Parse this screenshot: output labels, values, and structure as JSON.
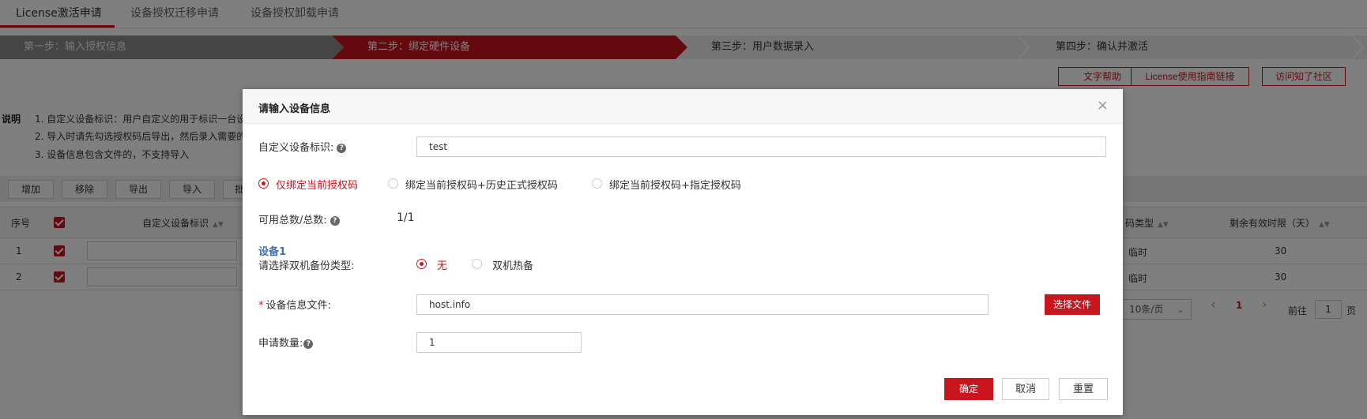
{
  "tabs": [
    {
      "label": "License激活申请"
    },
    {
      "label": "设备授权迁移申请"
    },
    {
      "label": "设备授权卸载申请"
    }
  ],
  "steps": [
    {
      "label": "第一步：输入授权信息"
    },
    {
      "label": "第二步：绑定硬件设备"
    },
    {
      "label": "第三步：用户数据录入"
    },
    {
      "label": "第四步：确认并激活"
    }
  ],
  "top_buttons": {
    "text_help": "文字帮助",
    "license_guide": "License使用指南链接",
    "community": "访问知了社区"
  },
  "description": {
    "label": "说明",
    "lines": [
      "1. 自定义设备标识：用户自定义的用于标识一台设",
      "2. 导入时请先勾选授权码后导出，然后录入需要的",
      "3. 设备信息包含文件的，不支持导入"
    ]
  },
  "toolbar": {
    "add": "增加",
    "remove": "移除",
    "export": "导出",
    "import": "导入",
    "batch": "批"
  },
  "table": {
    "headers": {
      "index": "序号",
      "device_id": "自定义设备标识",
      "code_type": "码类型",
      "remaining": "剩余有效时限（天）"
    },
    "rows": [
      {
        "index": "1",
        "code_type": "临时",
        "remaining": "30"
      },
      {
        "index": "2",
        "code_type": "临时",
        "remaining": "30"
      }
    ]
  },
  "pager": {
    "page_size": "10条/页",
    "prev": "‹",
    "current": "1",
    "next": "›",
    "goto_label": "前往",
    "goto_value": "1",
    "page_suffix": "页"
  },
  "modal": {
    "title": "请输入设备信息",
    "close": "×",
    "device_id_label": "自定义设备标识:",
    "device_id_value": "test",
    "bind_options": [
      {
        "label": "仅绑定当前授权码",
        "selected": true
      },
      {
        "label": "绑定当前授权码+历史正式授权码",
        "selected": false
      },
      {
        "label": "绑定当前授权码+指定授权码",
        "selected": false
      }
    ],
    "available_label": "可用总数/总数:",
    "available_value": "1/1",
    "device_section": "设备1",
    "backup_label": "请选择双机备份类型:",
    "backup_options": [
      {
        "label": "无",
        "selected": true
      },
      {
        "label": "双机热备",
        "selected": false
      }
    ],
    "required_mark": "*",
    "file_label": "设备信息文件:",
    "file_value": "host.info",
    "choose_file": "选择文件",
    "quantity_label": "申请数量:",
    "quantity_value": "1",
    "confirm": "确定",
    "cancel": "取消",
    "reset": "重置"
  },
  "colors": {
    "accent": "#c9151e",
    "section_blue": "#3f6fb5",
    "overlay": "rgba(0,0,0,0.5)"
  }
}
